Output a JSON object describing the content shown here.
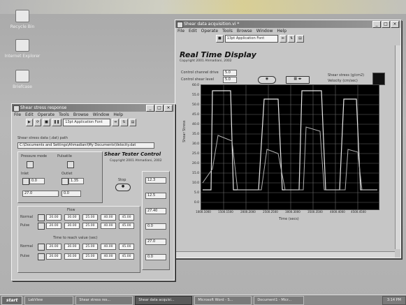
{
  "desktop": {
    "icons": [
      {
        "name": "recycle-bin-icon",
        "label": "Recycle Bin"
      },
      {
        "name": "internet-explorer-icon",
        "label": "Internet Explorer"
      },
      {
        "name": "briefcase-icon",
        "label": "Briefcase"
      }
    ]
  },
  "rtd_window": {
    "title": "Shear data acquisition.vi *",
    "menu": [
      "File",
      "Edit",
      "Operate",
      "Tools",
      "Browse",
      "Window",
      "Help"
    ],
    "font_select": "13pt Application Font",
    "heading": "Real Time Display",
    "copyright": "Copyright 2001 Ahmadiani, 2002",
    "controls": [
      {
        "label": "Control channel drive",
        "value": "5.0"
      },
      {
        "label": "Control shear level",
        "value": "5.0"
      }
    ],
    "right_labels": [
      "Shear stress (g/cm2)",
      "Velocity (cm/sec)"
    ],
    "y_ticks": [
      "60.0",
      "55.0",
      "50.0",
      "45.0",
      "40.0",
      "35.0",
      "30.0",
      "25.0",
      "20.0",
      "15.0",
      "10.0",
      "5.0",
      "0.0"
    ],
    "x_ticks": [
      "1000.1000",
      "1500.1500",
      "2000.2000",
      "2500.2500",
      "3000.3000",
      "3500.3500",
      "4000.4000",
      "4500.4500"
    ],
    "ylabel": "Shear Stress",
    "xlabel": "Time (secs)"
  },
  "stc_window": {
    "title": "Shear stress response",
    "menu": [
      "File",
      "Edit",
      "Operate",
      "Tools",
      "Browse",
      "Window",
      "Help"
    ],
    "font_select": "13pt Application Font",
    "path_label": "Shear stress data (.dat) path",
    "path_value": "C:\\Documents and Settings\\Ahmadiani\\My Documents\\Velocity.dat",
    "heading": "Shear Tester Control",
    "copyright": "Copyright 2001 Ahmadiani, 2002",
    "section_labels": [
      "Pressure mode",
      "Pulsatile",
      "Inlet",
      "Outlet"
    ],
    "stop_label": "Stop",
    "flow_title": "Flow",
    "flow_rows": [
      {
        "label": "Normal",
        "values": [
          "20.00",
          "30.00",
          "25.00",
          "40.00",
          "45.00"
        ]
      },
      {
        "label": "Pulse",
        "values": [
          "20.00",
          "30.00",
          "25.00",
          "40.00",
          "45.00"
        ]
      }
    ],
    "time_title": "Time to reach value (sec)",
    "time_rows": [
      {
        "label": "Normal",
        "values": [
          "20.00",
          "30.00",
          "25.00",
          "40.00",
          "45.00"
        ]
      },
      {
        "label": "Pulse",
        "values": [
          "20.00",
          "30.00",
          "25.00",
          "40.00",
          "45.00"
        ]
      }
    ],
    "side_values": [
      "12.3",
      "0.0",
      "1.35",
      "27.0",
      "0.0",
      "12.5",
      "27.40"
    ]
  },
  "taskbar": {
    "start": "start",
    "tasks": [
      "LabView",
      "Shear stress res...",
      "Shear data acquisi...",
      "Microsoft Word - S...",
      "Document1 - Micr..."
    ],
    "active_index": 2,
    "clock": "3:14 PM"
  }
}
